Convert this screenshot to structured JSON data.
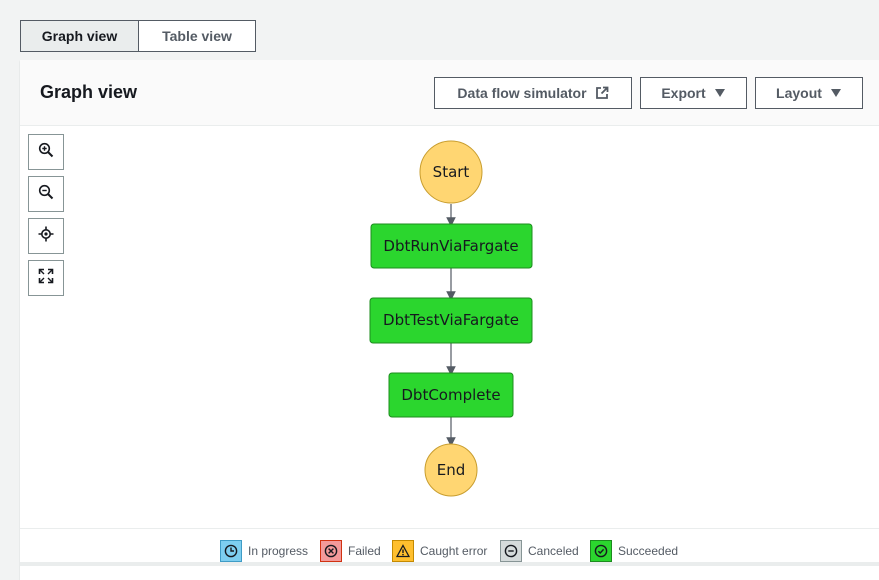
{
  "view_toggle": {
    "graph_label": "Graph view",
    "table_label": "Table view"
  },
  "panel": {
    "title": "Graph view",
    "buttons": {
      "simulator": "Data flow simulator",
      "export": "Export",
      "layout": "Layout"
    }
  },
  "zoom_controls": [
    "zoom-in-icon",
    "zoom-out-icon",
    "center-icon",
    "fit-icon"
  ],
  "graph": {
    "start": "Start",
    "states": [
      "DbtRunViaFargate",
      "DbtTestViaFargate",
      "DbtComplete"
    ],
    "end": "End",
    "colors": {
      "terminal_fill": "#ffd672",
      "terminal_stroke": "#c89d2e",
      "succeeded_fill": "#2bd62e",
      "succeeded_stroke": "#1c8c1e",
      "edge": "#545b64"
    }
  },
  "legend": {
    "in_progress": "In progress",
    "failed": "Failed",
    "caught_error": "Caught error",
    "canceled": "Canceled",
    "succeeded": "Succeeded",
    "colors": {
      "in_progress": "#7dcef0",
      "failed": "#f39a9a",
      "caught_error": "#ffbf2e",
      "canceled": "#d5dbdb",
      "succeeded": "#2bd62e"
    }
  }
}
